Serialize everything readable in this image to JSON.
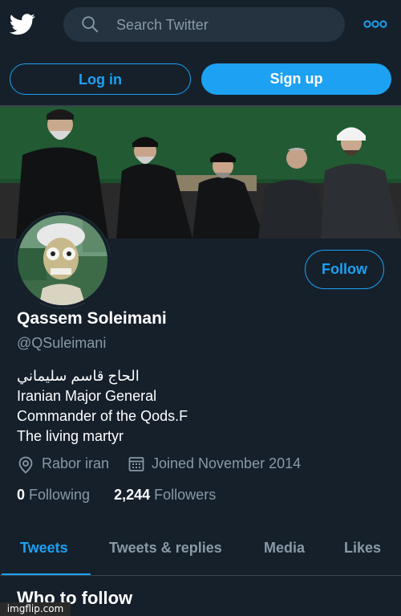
{
  "header": {
    "search_placeholder": "Search Twitter"
  },
  "auth": {
    "login_label": "Log in",
    "signup_label": "Sign up"
  },
  "profile": {
    "follow_label": "Follow",
    "name": "Qassem Soleimani",
    "handle": "@QSuleimani",
    "bio": [
      "الحاج قاسم سليماني",
      "Iranian Major General",
      "Commander of the Qods.F",
      "The living martyr"
    ],
    "location": "Rabor iran",
    "joined": "Joined November 2014",
    "following_count": "0",
    "following_label": "Following",
    "followers_count": "2,244",
    "followers_label": "Followers"
  },
  "tabs": [
    {
      "label": "Tweets",
      "active": true
    },
    {
      "label": "Tweets & replies",
      "active": false
    },
    {
      "label": "Media",
      "active": false
    },
    {
      "label": "Likes",
      "active": false
    }
  ],
  "who_to_follow": "Who to follow",
  "watermark": "imgflip.com",
  "colors": {
    "background": "#15202b",
    "accent": "#1da1f2",
    "muted": "#8899a6",
    "border": "#38444d"
  },
  "icons": [
    "twitter-bird-icon",
    "search-icon",
    "more-icon",
    "location-pin-icon",
    "calendar-icon"
  ]
}
